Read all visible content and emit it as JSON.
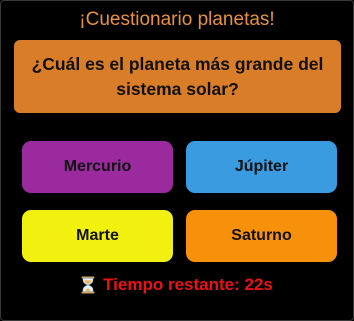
{
  "quiz": {
    "title": "¡Cuestionario planetas!",
    "question": "¿Cuál es el planeta más grande del sistema solar?",
    "answers": [
      {
        "label": "Mercurio",
        "color": "#9b2a9f"
      },
      {
        "label": "Júpiter",
        "color": "#3a9be0"
      },
      {
        "label": "Marte",
        "color": "#f2f00f"
      },
      {
        "label": "Saturno",
        "color": "#f7900a"
      }
    ],
    "timer": {
      "icon": "hourglass-icon",
      "text": "Tiempo restante: 22s"
    }
  },
  "colors": {
    "background": "#000000",
    "title": "#e8923a",
    "question_box": "#d97d28",
    "timer_text": "#ee1111"
  }
}
